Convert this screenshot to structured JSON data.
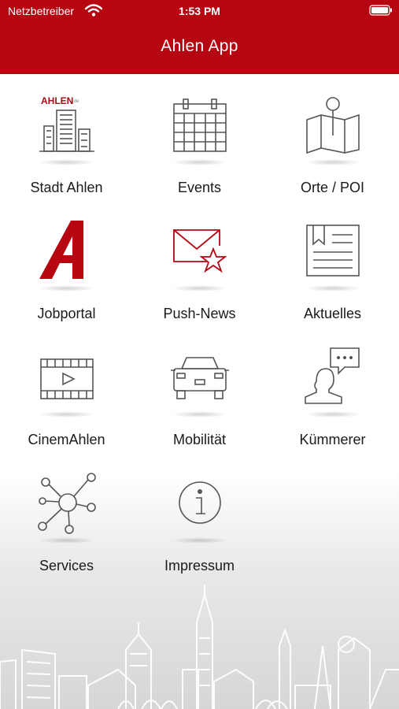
{
  "status_bar": {
    "carrier": "Netzbetreiber",
    "time": "1:53 PM"
  },
  "header": {
    "title": "Ahlen App"
  },
  "colors": {
    "brand_red": "#b50612",
    "icon_gray": "#555555"
  },
  "tiles": [
    {
      "label": "Stadt Ahlen",
      "icon": "city-buildings-icon",
      "logo_text": "AHLEN",
      "logo_suffix": ".de"
    },
    {
      "label": "Events",
      "icon": "calendar-icon"
    },
    {
      "label": "Orte / POI",
      "icon": "map-pin-icon"
    },
    {
      "label": "Jobportal",
      "icon": "jobportal-a-logo-icon"
    },
    {
      "label": "Push-News",
      "icon": "mail-star-icon"
    },
    {
      "label": "Aktuelles",
      "icon": "newspaper-icon"
    },
    {
      "label": "CinemAhlen",
      "icon": "film-play-icon"
    },
    {
      "label": "Mobilität",
      "icon": "car-icon"
    },
    {
      "label": "Kümmerer",
      "icon": "person-speech-icon"
    },
    {
      "label": "Services",
      "icon": "network-hub-icon"
    },
    {
      "label": "Impressum",
      "icon": "info-icon"
    }
  ]
}
